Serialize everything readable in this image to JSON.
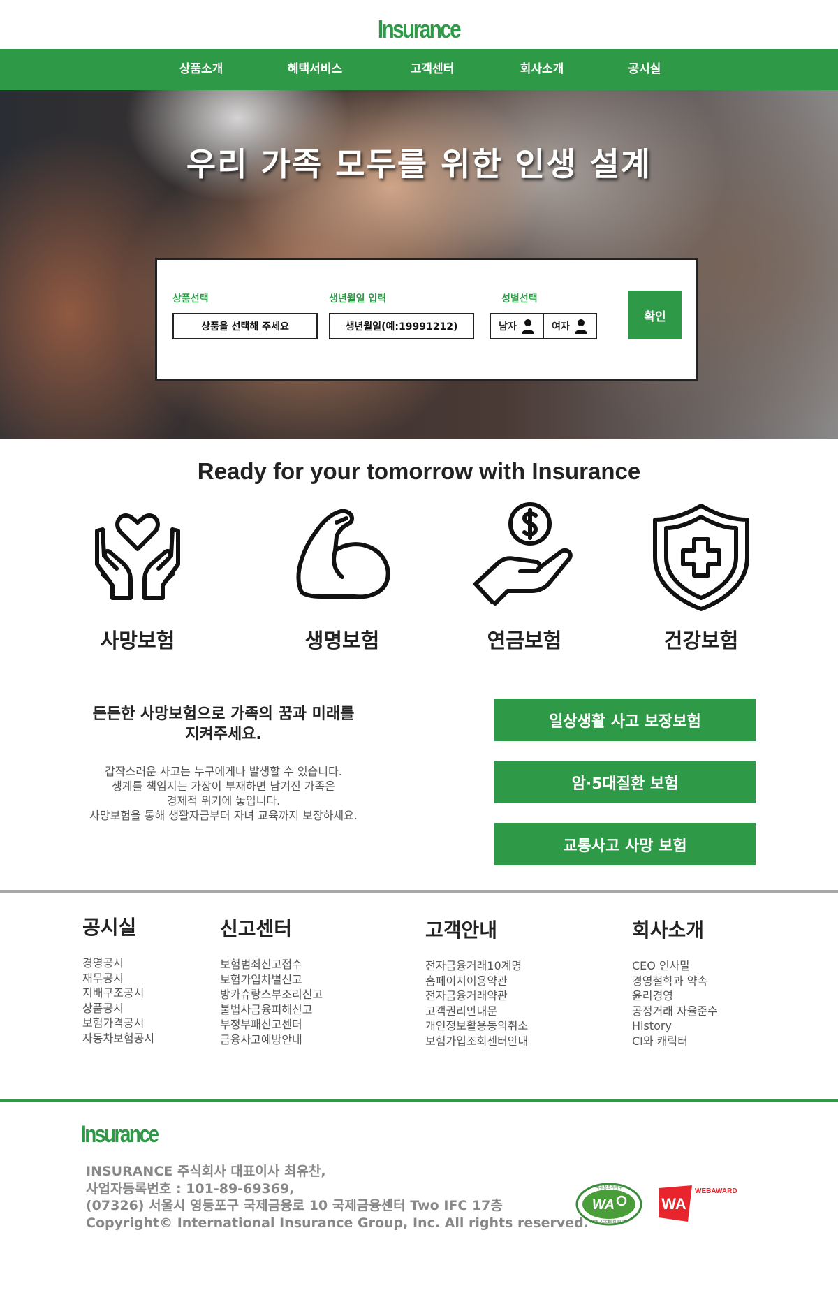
{
  "header": {
    "logo": "Insurance",
    "nav": [
      "상품소개",
      "혜택서비스",
      "고객센터",
      "회사소개",
      "공시실"
    ]
  },
  "hero": {
    "title": "우리 가족 모두를 위한 인생 설계",
    "form": {
      "product_label": "상품선택",
      "product_placeholder": "상품을 선택해 주세요",
      "birth_label": "생년월일 입력",
      "birth_placeholder": "생년월일(예:19991212)",
      "gender_label": "성별선택",
      "male": "남자",
      "female": "여자",
      "confirm": "확인"
    }
  },
  "section": {
    "tagline": "Ready for your tomorrow with Insurance",
    "products": [
      {
        "label": "사망보험",
        "icon": "hands-heart-icon"
      },
      {
        "label": "생명보험",
        "icon": "flexed-arm-icon"
      },
      {
        "label": "연금보험",
        "icon": "hand-coin-icon"
      },
      {
        "label": "건강보험",
        "icon": "shield-cross-icon"
      }
    ],
    "promo_title_lines": [
      "든든한 사망보험으로 가족의 꿈과 미래를",
      "지켜주세요."
    ],
    "promo_desc_lines": [
      "갑작스러운 사고는 누구에게나 발생할 수 있습니다.",
      "생계를 책임지는 가장이 부재하면 남겨진 가족은",
      "경제적 위기에 놓입니다.",
      "사망보험을 통해 생활자금부터 자녀 교육까지 보장하세요."
    ],
    "side_buttons": [
      "일상생활 사고 보장보험",
      "암·5대질환 보험",
      "교통사고 사망 보험"
    ]
  },
  "footer": {
    "columns": [
      {
        "title": "공시실",
        "links": [
          "경영공시",
          "재무공시",
          "지배구조공시",
          "상품공시",
          "보험가격공시",
          "자동차보험공시"
        ]
      },
      {
        "title": "신고센터",
        "links": [
          "보험범죄신고접수",
          "보험가입차별신고",
          "방카슈랑스부조리신고",
          "불법사금융피해신고",
          "부정부패신고센터",
          "금융사고예방안내"
        ]
      },
      {
        "title": "고객안내",
        "links": [
          "전자금융거래10계명",
          "홈페이지이용약관",
          "전자금융거래약관",
          "고객권리안내문",
          "개인정보활용동의취소",
          "보험가입조회센터안내"
        ]
      },
      {
        "title": "회사소개",
        "links": [
          "CEO 인사말",
          "경영철학과 약속",
          "윤리경영",
          "공정거래 자율준수",
          "History",
          "CI와 캐릭터"
        ]
      }
    ],
    "logo": "Insurance",
    "info_lines": [
      "INSURANCE 주식회사 대표이사 최유찬,",
      "사업자등록번호 : 101-89-69369,",
      "(07326) 서울시 영등포구 국제금융로 10 국제금융센터 Two IFC 17층",
      "Copyright© International Insurance Group, Inc. All rights reserved."
    ],
    "badges": {
      "wa_top": "미래창조과학부",
      "wa_main": "WA",
      "wa_bottom": "WEB ACCESSIBILITY",
      "award_mark": "WA",
      "award_text": "WEBAWARD"
    }
  },
  "colors": {
    "brand_green": "#2e9a47",
    "award_red": "#e8252c"
  }
}
